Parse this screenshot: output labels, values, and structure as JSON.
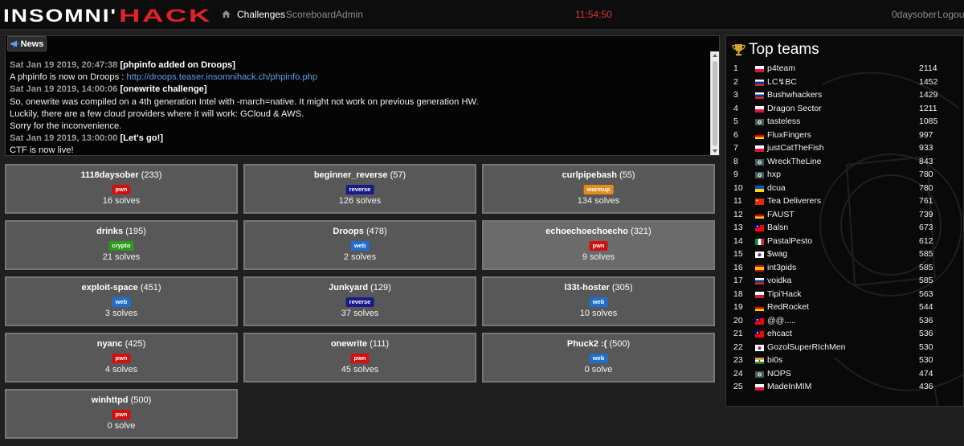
{
  "nav": {
    "logo_text": "INSOMNI'HACK",
    "links": [
      {
        "label": "Challenges",
        "active": true
      },
      {
        "label": "Scoreboard",
        "active": false
      },
      {
        "label": "Admin",
        "active": false
      }
    ],
    "clock": "11:54:50",
    "user": "0daysober",
    "logout": "Logout"
  },
  "news": {
    "tab_label": "News",
    "items": [
      {
        "date": "Sat Jan 19 2019, 20:47:38",
        "title": "[phpinfo added on Droops]",
        "lines": [
          [
            "A phpinfo is now on Droops : ",
            "http://droops.teaser.insomnihack.ch/phpinfo.php"
          ]
        ]
      },
      {
        "date": "Sat Jan 19 2019, 14:00:06",
        "title": "[onewrite challenge]",
        "lines": [
          [
            "So, onewrite was compiled on a 4th generation Intel with -march=native. It might not work on previous generation HW.",
            ""
          ],
          [
            "Luckily, there are a few cloud providers where it will work: GCloud & AWS.",
            ""
          ],
          [
            "Sorry for the inconvenience.",
            ""
          ]
        ]
      },
      {
        "date": "Sat Jan 19 2019, 13:00:00",
        "title": "[Let's go!]",
        "lines": [
          [
            "CTF is now live!",
            ""
          ]
        ]
      }
    ]
  },
  "tag_colors": {
    "pwn": "#d40f0f",
    "reverse": "#1a1a8a",
    "warmup": "#e8891c",
    "crypto": "#2c9a1c",
    "web": "#1f6fd1"
  },
  "challenges": [
    {
      "name": "1118daysober",
      "points": "(233)",
      "tag": "pwn",
      "solves": "16 solves"
    },
    {
      "name": "beginner_reverse",
      "points": "(57)",
      "tag": "reverse",
      "solves": "126 solves"
    },
    {
      "name": "curlpipebash",
      "points": "(55)",
      "tag": "warmup",
      "solves": "134 solves"
    },
    {
      "name": "drinks",
      "points": "(195)",
      "tag": "crypto",
      "solves": "21 solves"
    },
    {
      "name": "Droops",
      "points": "(478)",
      "tag": "web",
      "solves": "2 solves"
    },
    {
      "name": "echoechoechoecho",
      "points": "(321)",
      "tag": "pwn",
      "solves": "9 solves",
      "highlight": true
    },
    {
      "name": "exploit-space",
      "points": "(451)",
      "tag": "web",
      "solves": "3 solves"
    },
    {
      "name": "Junkyard",
      "points": "(129)",
      "tag": "reverse",
      "solves": "37 solves"
    },
    {
      "name": "l33t-hoster",
      "points": "(305)",
      "tag": "web",
      "solves": "10 solves"
    },
    {
      "name": "nyanc",
      "points": "(425)",
      "tag": "pwn",
      "solves": "4 solves"
    },
    {
      "name": "onewrite",
      "points": "(111)",
      "tag": "pwn",
      "solves": "45 solves"
    },
    {
      "name": "Phuck2 :(",
      "points": "(500)",
      "tag": "web",
      "solves": "0 solve"
    },
    {
      "name": "winhttpd",
      "points": "(500)",
      "tag": "pwn",
      "solves": "0 solve"
    }
  ],
  "top_teams": {
    "title": "Top teams",
    "teams": [
      {
        "rank": "1",
        "flag": "pl",
        "name": "p4team",
        "score": "2114"
      },
      {
        "rank": "2",
        "flag": "ru",
        "name": "LC↯BC",
        "score": "1452"
      },
      {
        "rank": "3",
        "flag": "ru",
        "name": "Bushwhackers",
        "score": "1429"
      },
      {
        "rank": "4",
        "flag": "pl",
        "name": "Dragon Sector",
        "score": "1211"
      },
      {
        "rank": "5",
        "flag": "multi",
        "name": "tasteless",
        "score": "1085"
      },
      {
        "rank": "6",
        "flag": "de",
        "name": "FluxFingers",
        "score": "997"
      },
      {
        "rank": "7",
        "flag": "pl",
        "name": "justCatTheFish",
        "score": "933"
      },
      {
        "rank": "8",
        "flag": "multi",
        "name": "WreckTheLine",
        "score": "843"
      },
      {
        "rank": "9",
        "flag": "multi",
        "name": "hxp",
        "score": "780"
      },
      {
        "rank": "10",
        "flag": "ua",
        "name": "dcua",
        "score": "780"
      },
      {
        "rank": "11",
        "flag": "cn",
        "name": "Tea Deliverers",
        "score": "761"
      },
      {
        "rank": "12",
        "flag": "de",
        "name": "FAUST",
        "score": "739"
      },
      {
        "rank": "13",
        "flag": "tw",
        "name": "Balsn",
        "score": "673"
      },
      {
        "rank": "14",
        "flag": "it",
        "name": "PastalPesto",
        "score": "612"
      },
      {
        "rank": "15",
        "flag": "kr",
        "name": "$wag",
        "score": "585"
      },
      {
        "rank": "16",
        "flag": "es",
        "name": "int3pids",
        "score": "585"
      },
      {
        "rank": "17",
        "flag": "ru",
        "name": "voidka",
        "score": "585"
      },
      {
        "rank": "18",
        "flag": "pl",
        "name": "Tipi'Hack",
        "score": "563"
      },
      {
        "rank": "19",
        "flag": "de",
        "name": "RedRocket",
        "score": "544"
      },
      {
        "rank": "20",
        "flag": "tw",
        "name": "@@.....",
        "score": "536"
      },
      {
        "rank": "21",
        "flag": "tw",
        "name": "ehcact",
        "score": "536"
      },
      {
        "rank": "22",
        "flag": "kr",
        "name": "GozolSuperRIchMen",
        "score": "530"
      },
      {
        "rank": "23",
        "flag": "in",
        "name": "bi0s",
        "score": "530"
      },
      {
        "rank": "24",
        "flag": "multi",
        "name": "NOPS",
        "score": "474"
      },
      {
        "rank": "25",
        "flag": "pl",
        "name": "MadeInMIM",
        "score": "436"
      }
    ]
  }
}
